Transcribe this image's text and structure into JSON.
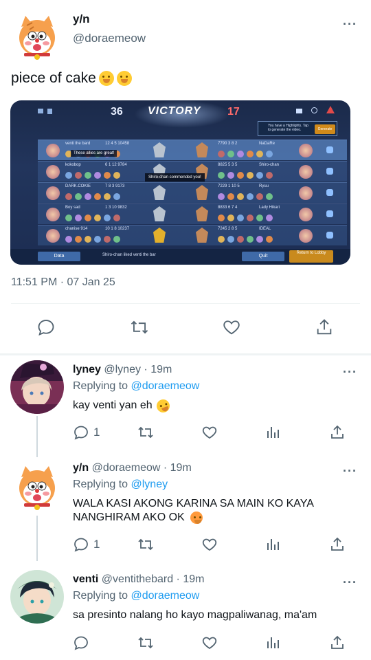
{
  "main_tweet": {
    "author_name": "y/n",
    "author_handle": "@doraemeow",
    "text": "piece of cake",
    "emojis": [
      "hand-over-mouth-emoji",
      "hand-over-mouth-emoji"
    ],
    "timestamp": "11:51 PM · 07 Jan 25",
    "media": {
      "left_score": "36",
      "right_score": "17",
      "result": "VICTORY",
      "left_players": [
        "venti the bard",
        "kokobop",
        "DARK.COKIE",
        "Boy sad",
        "chanise 914"
      ],
      "right_players": [
        "NaDaRe",
        "Shiro-chan",
        "Ryuu",
        "Lady Hikari",
        "IDEAL"
      ],
      "left_stats": [
        "12  4  5  10458",
        "6  1  12  9784",
        "7  8  3  9173",
        "1  3  10  9832",
        "10  1  8  10237"
      ],
      "right_stats": [
        "7790  3  8  2",
        "8825  5  3  5",
        "7229  1  10  5",
        "8833  6  7  4",
        "7245  2  8  5"
      ],
      "chat_bubble": "These allies are great!",
      "commend_popup": "Shiro-chan commended you!",
      "highlight_note": "You have a Highlights. Tap to generate the video.",
      "generate_button": "Generate",
      "bottom_note": "Shiro-chan liked venti the bar",
      "data_button": "Data",
      "quit_button": "Quit",
      "return_button": "Return to Lobby",
      "mvp_label": "MVP"
    },
    "actions": {
      "reply": "reply-icon",
      "retweet": "retweet-icon",
      "like": "heart-icon",
      "share": "share-icon"
    }
  },
  "replies": [
    {
      "author_name": "lyney",
      "author_meta": "@lyney · 19m",
      "replying_prefix": "Replying to",
      "replying_to": "@doraemeow",
      "text": "kay venti yan eh",
      "emoji": "rofl-emoji",
      "reply_count": "1"
    },
    {
      "author_name": "y/n",
      "author_meta": "@doraemeow · 19m",
      "replying_prefix": "Replying to",
      "replying_to": "@lyney",
      "text": "WALA KASI AKONG KARINA SA MAIN KO KAYA NANGHIRAM AKO OK",
      "emoji": "angry-emoji",
      "reply_count": "1"
    },
    {
      "author_name": "venti",
      "author_meta": "@ventithebard · 19m",
      "replying_prefix": "Replying to",
      "replying_to": "@doraemeow",
      "text": "sa presinto nalang ho kayo magpaliwanag, ma'am",
      "reply_count": ""
    }
  ],
  "colors": {
    "accent": "#1d9bf0",
    "muted": "#536471",
    "divider": "#eff3f4"
  }
}
